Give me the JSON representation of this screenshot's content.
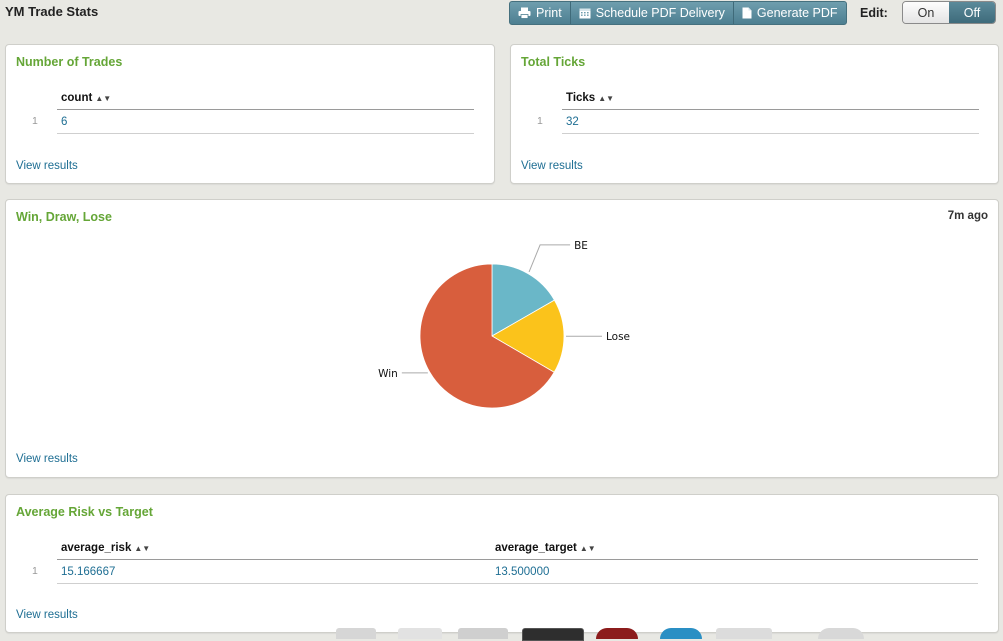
{
  "header": {
    "title": "YM Trade Stats",
    "buttons": {
      "print": "Print",
      "schedule": "Schedule PDF Delivery",
      "generate": "Generate PDF"
    },
    "edit_label": "Edit:",
    "toggle": {
      "on": "On",
      "off": "Off",
      "selected": "Off"
    }
  },
  "panels": {
    "trades": {
      "title": "Number of Trades",
      "column": "count",
      "row_number": "1",
      "value": "6",
      "view_results": "View results"
    },
    "ticks": {
      "title": "Total Ticks",
      "column": "Ticks",
      "row_number": "1",
      "value": "32",
      "view_results": "View results"
    },
    "pie": {
      "title": "Win, Draw, Lose",
      "timestamp": "7m ago",
      "view_results": "View results"
    },
    "risk": {
      "title": "Average Risk vs Target",
      "columns": [
        "average_risk",
        "average_target"
      ],
      "row_number": "1",
      "values": [
        "15.166667",
        "13.500000"
      ],
      "view_results": "View results"
    }
  },
  "chart_data": {
    "type": "pie",
    "categories": [
      "BE",
      "Lose",
      "Win"
    ],
    "values": [
      16.7,
      16.7,
      66.6
    ],
    "colors": [
      "#6ab7c8",
      "#fbc31b",
      "#d85e3d"
    ]
  }
}
